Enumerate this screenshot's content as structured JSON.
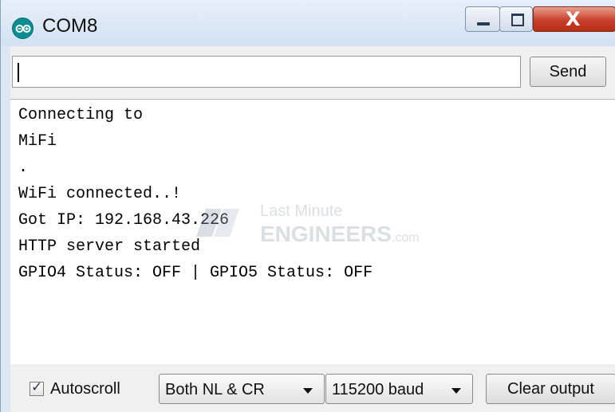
{
  "window": {
    "title": "COM8",
    "close_glyph": "X"
  },
  "send_row": {
    "input_value": "",
    "send_label": "Send"
  },
  "output": {
    "lines": [
      "Connecting to",
      "MiFi",
      ".",
      "WiFi connected..!",
      "Got IP: 192.168.43.226",
      "HTTP server started",
      "GPIO4 Status: OFF | GPIO5 Status: OFF"
    ]
  },
  "watermark": {
    "line1": "Last Minute",
    "line2": "ENGINEERS",
    "suffix": ".com"
  },
  "bottom_bar": {
    "autoscroll_label": "Autoscroll",
    "autoscroll_checked": true,
    "line_ending": "Both NL & CR",
    "baud_rate": "115200 baud",
    "clear_label": "Clear output"
  },
  "icons": {
    "app": "arduino-infinity-icon",
    "checkbox": "checkmark-icon",
    "dropdown": "chevron-down-icon"
  },
  "colors": {
    "titlebar": "#dce7f3",
    "close_button": "#c7402a",
    "app_icon": "#0d8c92"
  }
}
